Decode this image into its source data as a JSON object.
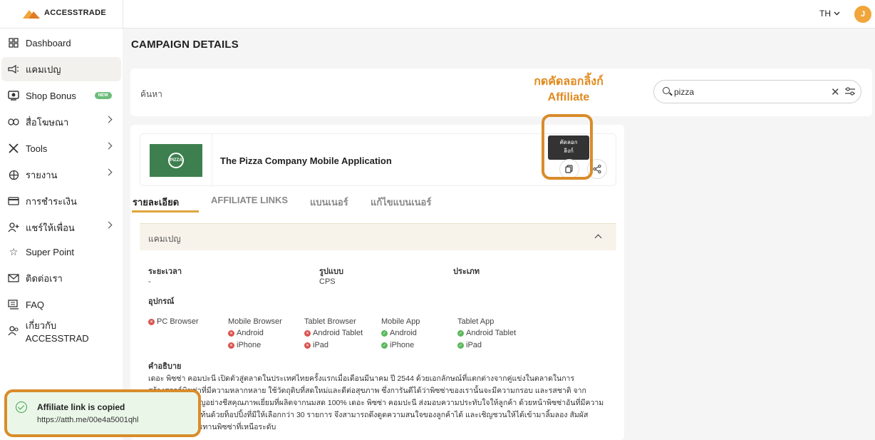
{
  "brand": {
    "name": "ACCESSTRADE"
  },
  "header": {
    "language": "TH",
    "avatar_initial": "J"
  },
  "sidebar": {
    "items": [
      {
        "label": "Dashboard",
        "icon": "dashboard-icon"
      },
      {
        "label": "แคมเปญ",
        "icon": "megaphone-icon"
      },
      {
        "label": "Shop Bonus",
        "icon": "shop-bonus-icon",
        "badge": "NEW"
      },
      {
        "label": "สื่อโฆษณา",
        "icon": "link-icon"
      },
      {
        "label": "Tools",
        "icon": "tools-icon"
      },
      {
        "label": "รายงาน",
        "icon": "report-icon"
      },
      {
        "label": "การชำระเงิน",
        "icon": "card-icon"
      },
      {
        "label": "แชร์ให้เพื่อน",
        "icon": "share-user-icon"
      },
      {
        "label": "Super Point",
        "icon": "star-icon"
      },
      {
        "label": "ติดต่อเรา",
        "icon": "mail-icon"
      },
      {
        "label": "FAQ",
        "icon": "faq-icon"
      },
      {
        "label": "เกี่ยวกับ ACCESSTRAD",
        "icon": "about-icon"
      }
    ]
  },
  "page": {
    "title": "CAMPAIGN DETAILS"
  },
  "search": {
    "label": "ค้นหา",
    "value": "pizza"
  },
  "annotation": {
    "line1": "กดคัดลอกลิ้งก์",
    "line2": "Affiliate"
  },
  "campaign": {
    "logo_text": "PIZZA",
    "name": "The Pizza Company Mobile Application",
    "tooltip_line1": "คัดลอก",
    "tooltip_line2": "ลิงก์"
  },
  "tabs": [
    {
      "label": "รายละเอียด"
    },
    {
      "label": "AFFILIATE LINKS"
    },
    {
      "label": "แบนเนอร์"
    },
    {
      "label": "แก้ไขแบนเนอร์"
    }
  ],
  "section": {
    "title": "แคมเปญ"
  },
  "details": {
    "period_label": "ระยะเวลา",
    "period_value": "-",
    "format_label": "รูปแบบ",
    "format_value": "CPS",
    "type_label": "ประเภท",
    "device_label": "อุปกรณ์",
    "desc_label": "คำอธิบาย"
  },
  "devices": {
    "pc": "PC Browser",
    "mobile_browser": {
      "title": "Mobile Browser",
      "items": [
        "Android",
        "iPhone"
      ]
    },
    "tablet_browser": {
      "title": "Tablet Browser",
      "items": [
        "Android Tablet",
        "iPad"
      ]
    },
    "mobile_app": {
      "title": "Mobile App",
      "items": [
        "Android",
        "iPhone"
      ]
    },
    "tablet_app": {
      "title": "Tablet App",
      "items": [
        "Android Tablet",
        "iPad"
      ]
    }
  },
  "description": "เดอะ พิซซ่า คอมปะนี เปิดตัวสู่ตลาดในประเทศไทยครั้งแรกเมื่อเดือนมีนาคม ปี 2544 ด้วยเอกลักษณ์ที่แตกต่างจากคู่แข่งในตลาดในการ สร้างสรรค์พิซซ่าที่มีความหลากหลาย ใช้วัตถุดิบที่สดใหม่และดีต่อสุขภาพ ซึ่งการันตีได้ว่าพิซซ่าของเรานั้นจะมีความกรอบ และรสชาติ จากวัตถุดิบหลักสำคัญอย่างชีสคุณภาพเยี่ยมที่ผลิตจากนมสด 100% เดอะ พิซซ่า คอมปะนี ส่งมอบความประทับใจให้ลูกค้า ด้วยหน้าพิซซ่าอันที่มีความหลากหลาย ท่วมท้นด้วยท็อปปิ้งที่มีให้เลือกกว่า 30 รายการ จึงสามารถดึงดูดความสนใจของลูกค้าได้ และเชิญชวนให้ได้เข้ามาลิ้มลอง สัมผัสประสบการณ์การทานพิซซ่าที่เหนือระดับ",
  "toast": {
    "title": "Affiliate link is copied",
    "url": "https://atth.me/00e4a5001qhl"
  },
  "colors": {
    "accent": "#e0a53c",
    "annotation": "#d98c2b",
    "success": "#3aa24c",
    "brand_green": "#3e7f4f"
  }
}
